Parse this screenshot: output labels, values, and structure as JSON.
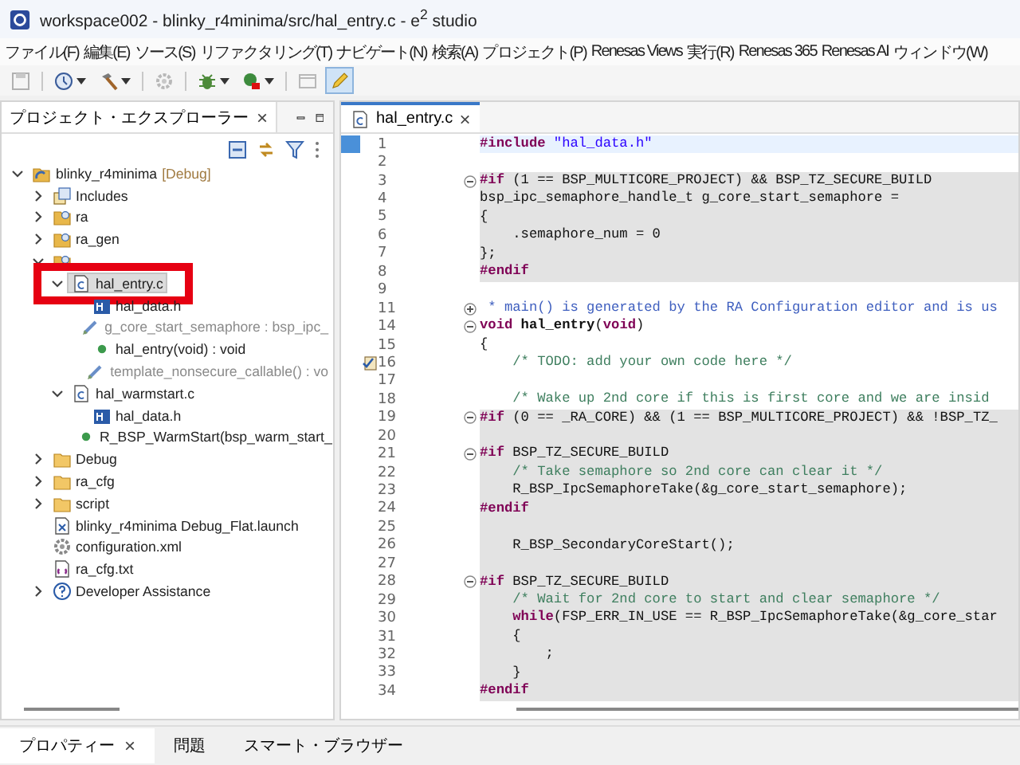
{
  "window": {
    "title": "workspace002 - blinky_r4minima/src/hal_entry.c - e$^{2}$ studio"
  },
  "menu": [
    "ファイル(F)",
    "編集(E)",
    "ソース(S)",
    "リファクタリング(T)",
    "ナビゲート(N)",
    "検索(A)",
    "プロジェクト(P)",
    "Renesas Views",
    "実行(R)",
    "Renesas 365",
    "Renesas AI",
    "ウィンドウ(W)"
  ],
  "toolbar": [
    {
      "kind": "save",
      "disabled": true,
      "dropdown": false,
      "selected": false
    },
    {
      "kind": "build-config",
      "disabled": false,
      "dropdown": true,
      "selected": false
    },
    {
      "kind": "hammer",
      "disabled": false,
      "dropdown": true,
      "selected": false
    },
    {
      "kind": "gear",
      "disabled": true,
      "dropdown": false,
      "selected": false
    },
    {
      "kind": "bug",
      "disabled": false,
      "dropdown": true,
      "selected": false
    },
    {
      "kind": "run",
      "disabled": false,
      "dropdown": true,
      "selected": false
    },
    {
      "kind": "window",
      "disabled": true,
      "dropdown": false,
      "selected": false
    },
    {
      "kind": "pen",
      "disabled": false,
      "dropdown": false,
      "selected": true
    }
  ],
  "explorer": {
    "tab": {
      "label": "プロジェクト・エクスプローラー",
      "close": "×"
    },
    "tree": [
      {
        "label": "blinky_r4minima",
        "decoration": "[Debug]",
        "kind": "project",
        "expanded": true,
        "selected": false,
        "highlighted": false,
        "children": [
          {
            "label": "Includes",
            "kind": "includes",
            "expanded": false,
            "selected": false,
            "highlighted": false
          },
          {
            "label": "ra",
            "kind": "src-folder",
            "expanded": false,
            "selected": false,
            "highlighted": false
          },
          {
            "label": "ra_gen",
            "kind": "src-folder",
            "expanded": false,
            "selected": false,
            "highlighted": false
          },
          {
            "kind": "src-folder",
            "expanded": true,
            "selected": false,
            "highlighted": false,
            "children": [
              {
                "label": "hal_entry.c",
                "kind": "c-file",
                "expanded": true,
                "selected": true,
                "highlighted": true,
                "children": [
                  {
                    "label": "hal_data.h",
                    "kind": "header",
                    "selected": false,
                    "highlighted": false,
                    "dimmed": false
                  },
                  {
                    "label": "g_core_start_semaphore : bsp_ipc_",
                    "kind": "variable",
                    "selected": false,
                    "highlighted": false,
                    "dimmed": true
                  },
                  {
                    "label": "hal_entry(void) : void",
                    "kind": "function",
                    "selected": false,
                    "highlighted": false,
                    "dimmed": false
                  },
                  {
                    "label": "template_nonsecure_callable() : vo",
                    "kind": "variable",
                    "selected": false,
                    "highlighted": false,
                    "dimmed": true
                  }
                ]
              },
              {
                "label": "hal_warmstart.c",
                "kind": "c-file",
                "expanded": true,
                "selected": false,
                "highlighted": false,
                "children": [
                  {
                    "label": "hal_data.h",
                    "kind": "header",
                    "selected": false,
                    "highlighted": false,
                    "dimmed": false
                  },
                  {
                    "label": "R_BSP_WarmStart(bsp_warm_start_",
                    "kind": "function",
                    "selected": false,
                    "highlighted": false,
                    "dimmed": false
                  }
                ]
              }
            ]
          },
          {
            "label": "Debug",
            "kind": "folder",
            "expanded": false,
            "selected": false,
            "highlighted": false
          },
          {
            "label": "ra_cfg",
            "kind": "folder",
            "expanded": false,
            "selected": false,
            "highlighted": false
          },
          {
            "label": "script",
            "kind": "folder",
            "expanded": false,
            "selected": false,
            "highlighted": false
          },
          {
            "label": "blinky_r4minima Debug_Flat.launch",
            "kind": "launch",
            "selected": false,
            "highlighted": false
          },
          {
            "label": "configuration.xml",
            "kind": "config",
            "selected": false,
            "highlighted": false
          },
          {
            "label": "ra_cfg.txt",
            "kind": "text",
            "selected": false,
            "highlighted": false
          },
          {
            "label": "Developer Assistance",
            "kind": "help",
            "expanded": false,
            "selected": false,
            "highlighted": false
          }
        ]
      }
    ]
  },
  "editor": {
    "tab": {
      "label": "hal_entry.c",
      "close": "×"
    },
    "lines": [
      {
        "n": "1",
        "current": true,
        "shaded": false,
        "segs": [
          {
            "kind": "pre",
            "t": "#include"
          },
          {
            "kind": "str",
            "t": " \"hal_data.h\""
          }
        ]
      },
      {
        "n": "2",
        "current": false,
        "shaded": false
      },
      {
        "n": "3",
        "current": false,
        "shaded": true,
        "folded": false,
        "segs": [
          {
            "kind": "pre",
            "t": "#if"
          },
          {
            "kind": "plain",
            "t": " (1 == BSP_MULTICORE_PROJECT) && BSP_TZ_SECURE_BUILD"
          }
        ]
      },
      {
        "n": "4",
        "current": false,
        "shaded": true,
        "segs": [
          {
            "kind": "plain",
            "t": "bsp_ipc_semaphore_handle_t g_core_start_semaphore ="
          }
        ]
      },
      {
        "n": "5",
        "current": false,
        "shaded": true,
        "segs": [
          {
            "kind": "plain",
            "t": "{"
          }
        ]
      },
      {
        "n": "6",
        "current": false,
        "shaded": true,
        "segs": [
          {
            "kind": "plain",
            "t": "    .semaphore_num = 0"
          }
        ]
      },
      {
        "n": "7",
        "current": false,
        "shaded": true,
        "segs": [
          {
            "kind": "plain",
            "t": "};"
          }
        ]
      },
      {
        "n": "8",
        "current": false,
        "shaded": true,
        "segs": [
          {
            "kind": "pre",
            "t": "#endif"
          }
        ]
      },
      {
        "n": "9",
        "current": false,
        "shaded": false
      },
      {
        "n": "11",
        "current": false,
        "shaded": false,
        "folded": true,
        "segs": [
          {
            "kind": "doc",
            "t": " * main() is generated by the RA Configuration editor and is us"
          }
        ]
      },
      {
        "n": "14",
        "current": false,
        "shaded": false,
        "folded": false,
        "segs": [
          {
            "kind": "kw",
            "t": "void"
          },
          {
            "kind": "fn",
            "t": " hal_entry"
          },
          {
            "kind": "plain",
            "t": "("
          },
          {
            "kind": "kw",
            "t": "void"
          },
          {
            "kind": "plain",
            "t": ")"
          }
        ]
      },
      {
        "n": "15",
        "current": false,
        "shaded": false,
        "segs": [
          {
            "kind": "plain",
            "t": "{"
          }
        ]
      },
      {
        "n": "16",
        "current": false,
        "shaded": false,
        "task": true,
        "segs": [
          {
            "kind": "com",
            "t": "    /* TODO: add your own code here */"
          }
        ]
      },
      {
        "n": "17",
        "current": false,
        "shaded": false
      },
      {
        "n": "18",
        "current": false,
        "shaded": false,
        "segs": [
          {
            "kind": "com",
            "t": "    /* Wake up 2nd core if this is first core and we are insid"
          }
        ]
      },
      {
        "n": "19",
        "current": false,
        "shaded": true,
        "folded": false,
        "segs": [
          {
            "kind": "pre",
            "t": "#if"
          },
          {
            "kind": "plain",
            "t": " (0 == _RA_CORE) && (1 == BSP_MULTICORE_PROJECT) && !BSP_TZ_"
          }
        ]
      },
      {
        "n": "20",
        "current": false,
        "shaded": true
      },
      {
        "n": "21",
        "current": false,
        "shaded": true,
        "folded": false,
        "segs": [
          {
            "kind": "pre",
            "t": "#if"
          },
          {
            "kind": "plain",
            "t": " BSP_TZ_SECURE_BUILD"
          }
        ]
      },
      {
        "n": "22",
        "current": false,
        "shaded": true,
        "segs": [
          {
            "kind": "com",
            "t": "    /* Take semaphore so 2nd core can clear it */"
          }
        ]
      },
      {
        "n": "23",
        "current": false,
        "shaded": true,
        "segs": [
          {
            "kind": "plain",
            "t": "    R_BSP_IpcSemaphoreTake(&g_core_start_semaphore);"
          }
        ]
      },
      {
        "n": "24",
        "current": false,
        "shaded": true,
        "segs": [
          {
            "kind": "pre",
            "t": "#endif"
          }
        ]
      },
      {
        "n": "25",
        "current": false,
        "shaded": true
      },
      {
        "n": "26",
        "current": false,
        "shaded": true,
        "segs": [
          {
            "kind": "plain",
            "t": "    R_BSP_SecondaryCoreStart();"
          }
        ]
      },
      {
        "n": "27",
        "current": false,
        "shaded": true
      },
      {
        "n": "28",
        "current": false,
        "shaded": true,
        "folded": false,
        "segs": [
          {
            "kind": "pre",
            "t": "#if"
          },
          {
            "kind": "plain",
            "t": " BSP_TZ_SECURE_BUILD"
          }
        ]
      },
      {
        "n": "29",
        "current": false,
        "shaded": true,
        "segs": [
          {
            "kind": "com",
            "t": "    /* Wait for 2nd core to start and clear semaphore */"
          }
        ]
      },
      {
        "n": "30",
        "current": false,
        "shaded": true,
        "segs": [
          {
            "kind": "kw",
            "t": "    while"
          },
          {
            "kind": "plain",
            "t": "(FSP_ERR_IN_USE == R_BSP_IpcSemaphoreTake(&g_core_star"
          }
        ]
      },
      {
        "n": "31",
        "current": false,
        "shaded": true,
        "segs": [
          {
            "kind": "plain",
            "t": "    {"
          }
        ]
      },
      {
        "n": "32",
        "current": false,
        "shaded": true,
        "segs": [
          {
            "kind": "plain",
            "t": "        ;"
          }
        ]
      },
      {
        "n": "33",
        "current": false,
        "shaded": true,
        "segs": [
          {
            "kind": "plain",
            "t": "    }"
          }
        ]
      },
      {
        "n": "34",
        "current": false,
        "shaded": true,
        "segs": [
          {
            "kind": "pre",
            "t": "#endif"
          }
        ]
      }
    ]
  },
  "bottom_tabs": [
    {
      "label": "プロパティー",
      "close": "×",
      "selected": true
    },
    {
      "label": "問題",
      "selected": false
    },
    {
      "label": "スマート・ブラウザー",
      "selected": false
    }
  ]
}
